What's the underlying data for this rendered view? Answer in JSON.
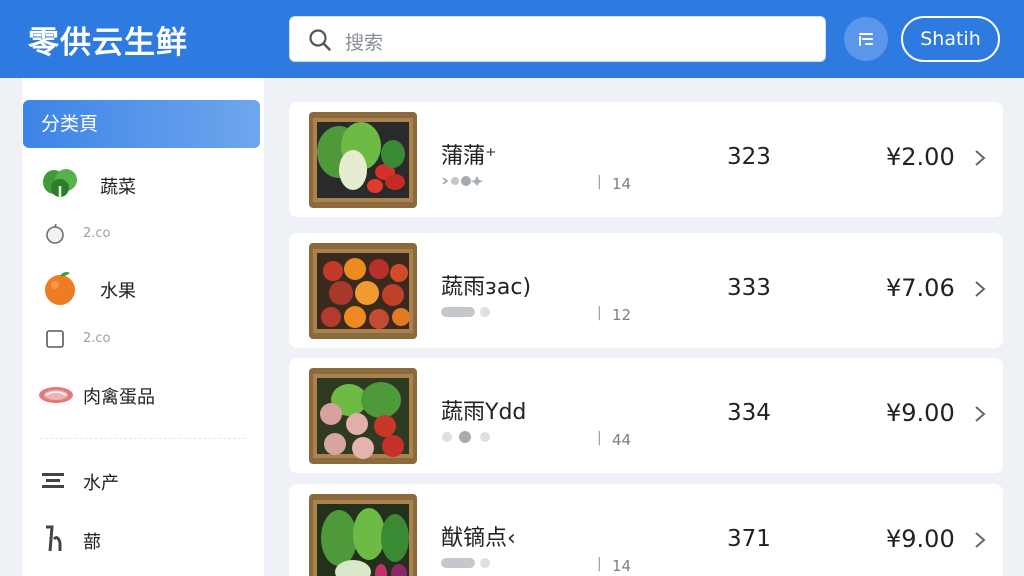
{
  "header": {
    "app_name": "零供云生鲜",
    "search_placeholder": "搜索",
    "user_label": "Shatih",
    "brand_color": "#2d7ae0"
  },
  "sidebar": {
    "active_category": "分类頁",
    "items": [
      {
        "label": "蔬菜",
        "icon": "leafy-vegetable-icon"
      },
      {
        "label": "2.co",
        "icon": "apple-outline-icon"
      },
      {
        "label": "水果",
        "icon": "orange-fruit-icon"
      },
      {
        "label": "2.co",
        "icon": "square-outline-icon"
      },
      {
        "label": "肉禽蛋品",
        "icon": "meat-icon"
      },
      {
        "label": "水产",
        "icon": "fish-icon"
      },
      {
        "label": "蔀",
        "icon": "plant-icon"
      }
    ]
  },
  "products": [
    {
      "name": "蒲蒲⁺",
      "stock": "14",
      "sales": "323",
      "price": "¥2.00"
    },
    {
      "name": "蔬雨ᴈac)",
      "stock": "12",
      "sales": "333",
      "price": "¥7.06"
    },
    {
      "name": "蔬雨Ydd",
      "stock": "44",
      "sales": "334",
      "price": "¥9.00"
    },
    {
      "name": "猷镝点‹",
      "stock": "14",
      "sales": "371",
      "price": "¥9.00"
    }
  ]
}
